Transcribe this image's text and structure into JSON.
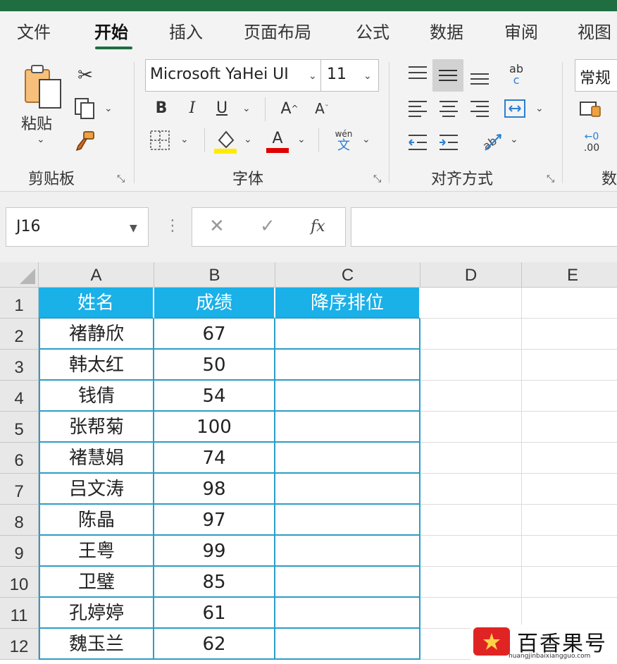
{
  "ribbon_tabs": [
    "文件",
    "开始",
    "插入",
    "页面布局",
    "公式",
    "数据",
    "审阅",
    "视图"
  ],
  "active_tab": "开始",
  "clipboard": {
    "paste_label": "粘贴",
    "group_label": "剪贴板"
  },
  "font": {
    "name": "Microsoft YaHei UI",
    "size": "11",
    "bold": "B",
    "italic": "I",
    "underline": "U",
    "grow": "A",
    "shrink": "A",
    "font_color_letter": "A",
    "phonetic_top": "wén",
    "phonetic_bottom": "文",
    "group_label": "字体",
    "highlight_color": "#ffeb00",
    "font_color": "#e00000"
  },
  "alignment": {
    "wrap_top": "ab",
    "wrap_bottom": "c",
    "group_label": "对齐方式"
  },
  "number": {
    "format": "常规",
    "dec_top": "←0",
    "dec_bottom": ".00",
    "group_label": "数"
  },
  "formula_bar": {
    "name_box": "J16",
    "cancel": "✕",
    "enter": "✓",
    "fx": "fx",
    "content": ""
  },
  "sheet": {
    "col_headers": [
      "A",
      "B",
      "C",
      "D",
      "E"
    ],
    "row_headers": [
      "1",
      "2",
      "3",
      "4",
      "5",
      "6",
      "7",
      "8",
      "9",
      "10",
      "11",
      "12"
    ],
    "header_row": [
      "姓名",
      "成绩",
      "降序排位"
    ],
    "rows": [
      [
        "褚静欣",
        "67",
        ""
      ],
      [
        "韩太红",
        "50",
        ""
      ],
      [
        "钱倩",
        "54",
        ""
      ],
      [
        "张帮菊",
        "100",
        ""
      ],
      [
        "褚慧娟",
        "74",
        ""
      ],
      [
        "吕文涛",
        "98",
        ""
      ],
      [
        "陈晶",
        "97",
        ""
      ],
      [
        "王粤",
        "99",
        ""
      ],
      [
        "卫璧",
        "85",
        ""
      ],
      [
        "孔婷婷",
        "61",
        ""
      ],
      [
        "魏玉兰",
        "62",
        ""
      ]
    ],
    "header_fill": "#1ab0e8",
    "border_color": "#2d9dc6"
  },
  "watermark": {
    "name": "百香果号",
    "url": "huangjinbaixiangguo.com"
  }
}
